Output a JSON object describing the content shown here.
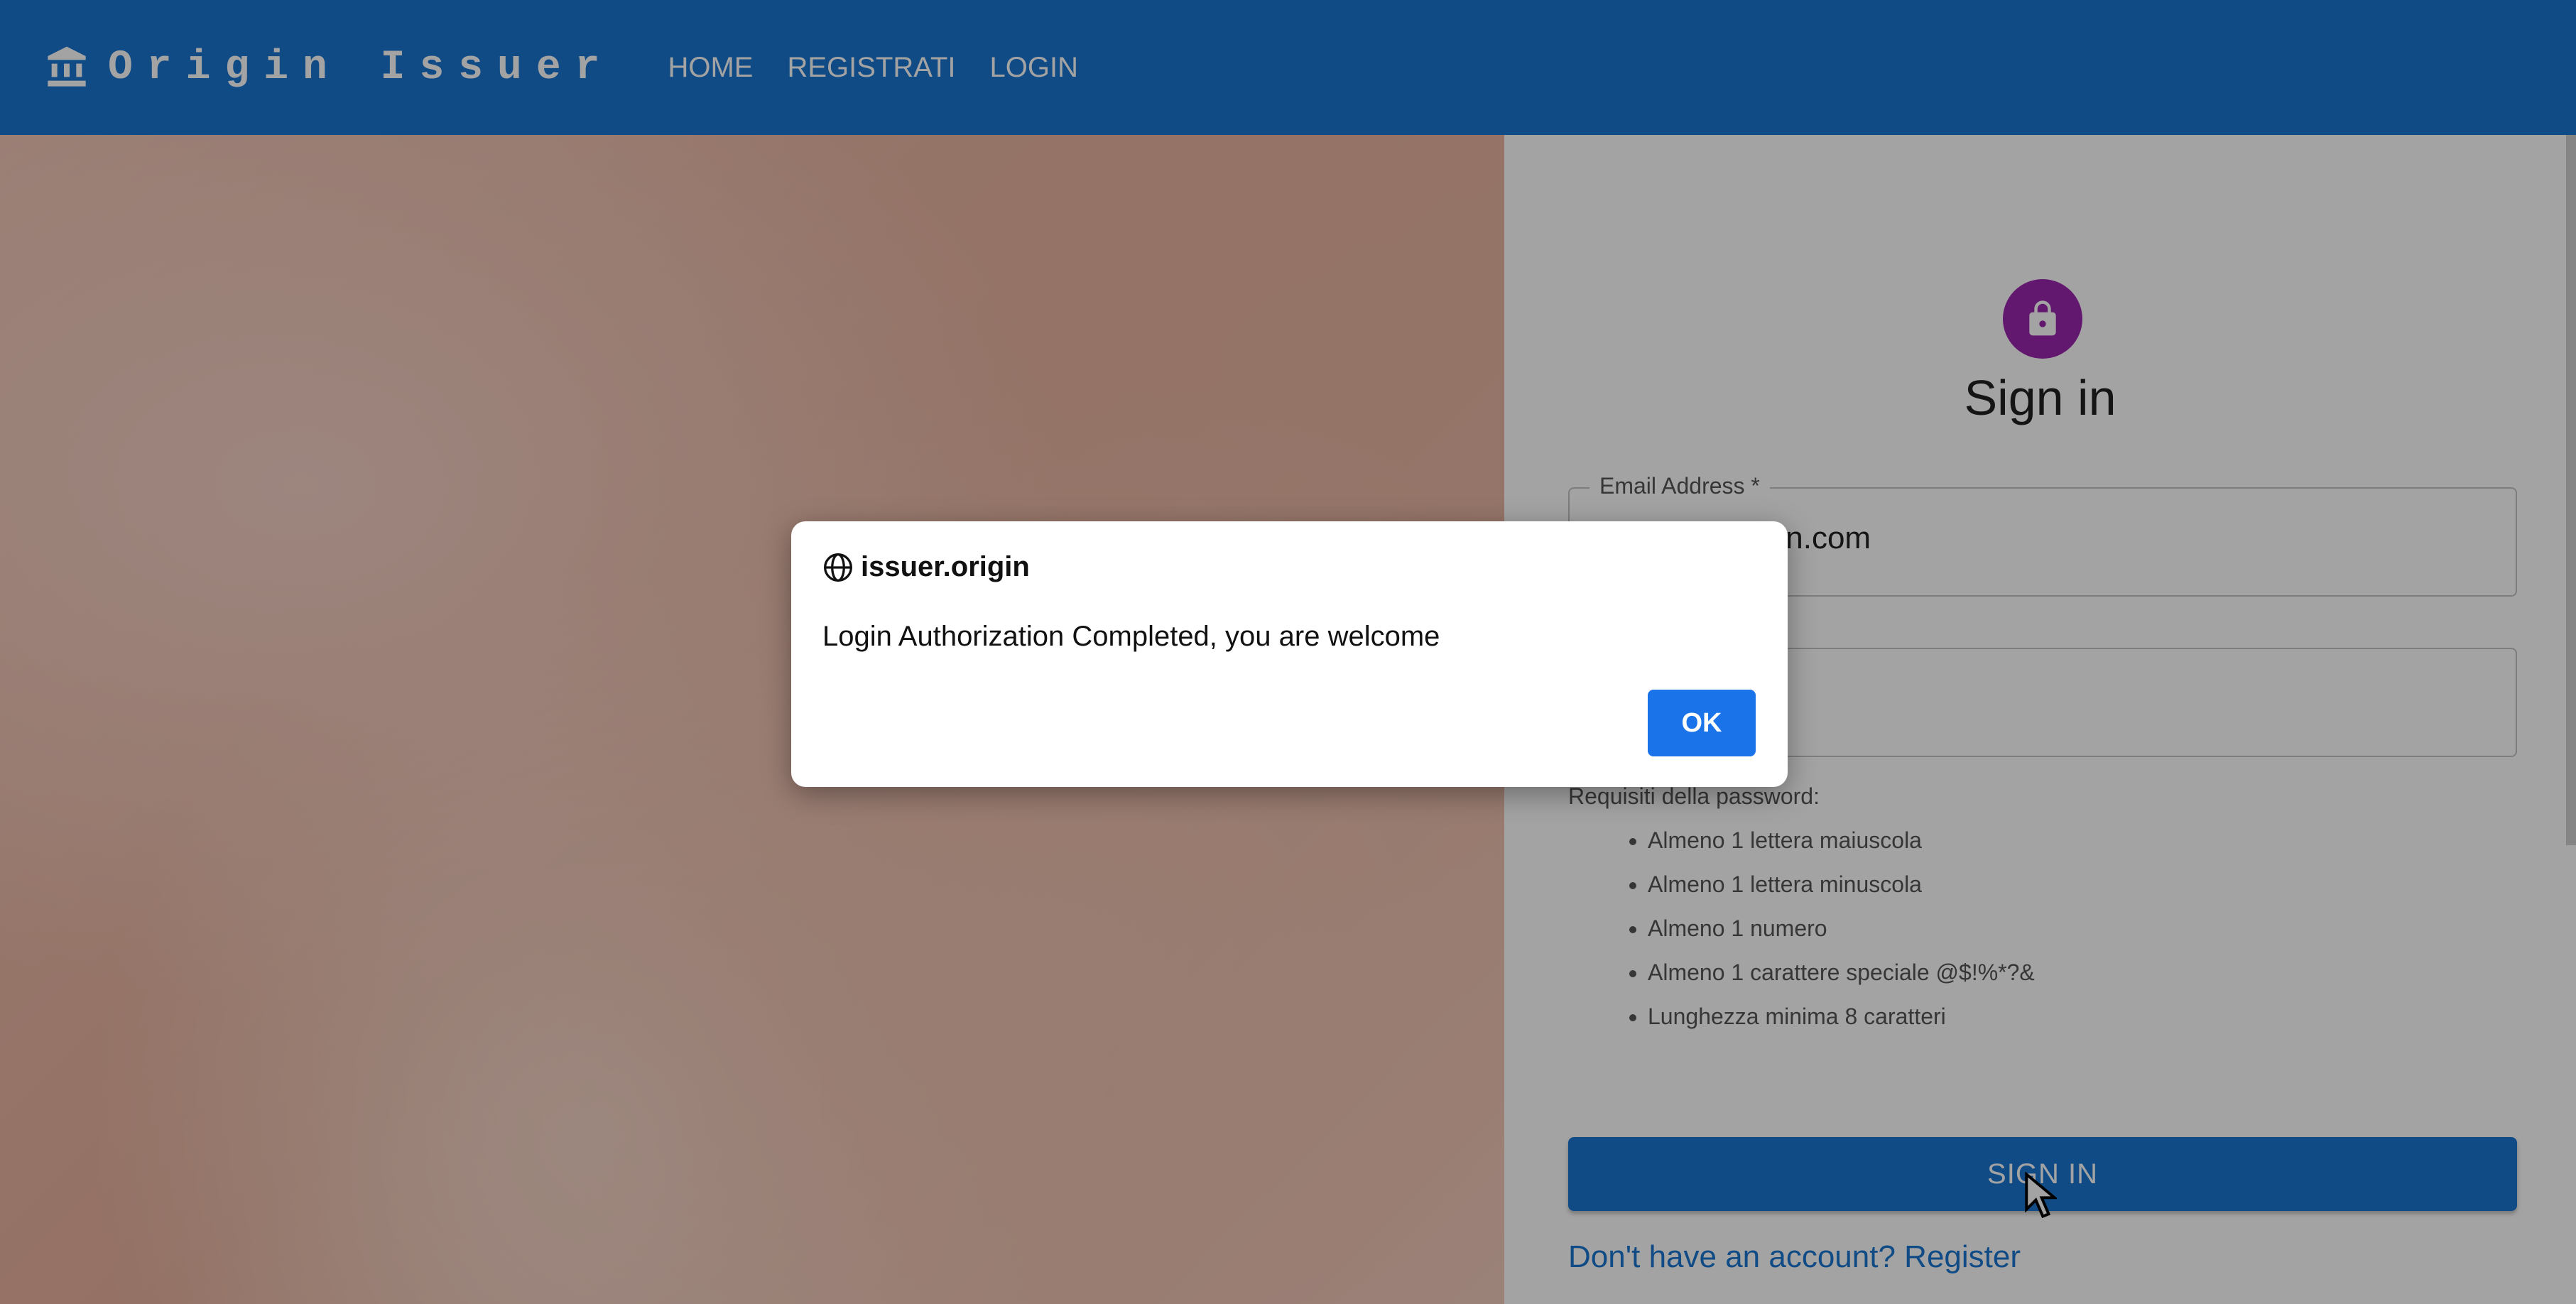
{
  "appbar": {
    "brand_icon": "bank-icon",
    "title": "Origin Issuer",
    "nav": [
      {
        "label": "HOME"
      },
      {
        "label": "REGISTRATI"
      },
      {
        "label": "LOGIN"
      }
    ]
  },
  "signin": {
    "avatar_icon": "lock-icon",
    "title": "Sign in",
    "email": {
      "label": "Email Address *",
      "value": "nin.com"
    },
    "password": {
      "value": ""
    },
    "requirements_title": "Requisiti della password:",
    "requirements": [
      "Almeno 1 lettera maiuscola",
      "Almeno 1 lettera minuscola",
      "Almeno 1 numero",
      "Almeno 1 carattere speciale @$!%*?&",
      "Lunghezza minima 8 caratteri"
    ],
    "submit_label": "SIGN IN",
    "register_link": "Don't have an account? Register"
  },
  "dialog": {
    "origin_icon": "globe-icon",
    "origin": "issuer.origin",
    "message": "Login Authorization Completed, you are welcome",
    "ok_label": "OK"
  },
  "colors": {
    "primary": "#1976d2",
    "avatar": "#9c27b0",
    "dialog_button": "#1a73e8"
  }
}
